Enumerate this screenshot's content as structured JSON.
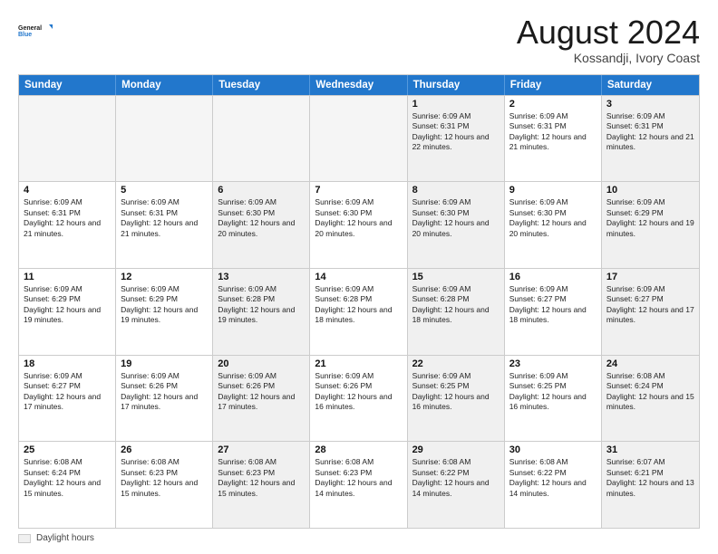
{
  "logo": {
    "line1": "General",
    "line2": "Blue"
  },
  "header": {
    "title": "August 2024",
    "subtitle": "Kossandji, Ivory Coast"
  },
  "days": [
    "Sunday",
    "Monday",
    "Tuesday",
    "Wednesday",
    "Thursday",
    "Friday",
    "Saturday"
  ],
  "legend": {
    "box_label": "Daylight hours"
  },
  "weeks": [
    [
      {
        "day": "",
        "content": ""
      },
      {
        "day": "",
        "content": ""
      },
      {
        "day": "",
        "content": ""
      },
      {
        "day": "",
        "content": ""
      },
      {
        "day": "1",
        "content": "Sunrise: 6:09 AM\nSunset: 6:31 PM\nDaylight: 12 hours and 22 minutes."
      },
      {
        "day": "2",
        "content": "Sunrise: 6:09 AM\nSunset: 6:31 PM\nDaylight: 12 hours and 21 minutes."
      },
      {
        "day": "3",
        "content": "Sunrise: 6:09 AM\nSunset: 6:31 PM\nDaylight: 12 hours and 21 minutes."
      }
    ],
    [
      {
        "day": "4",
        "content": "Sunrise: 6:09 AM\nSunset: 6:31 PM\nDaylight: 12 hours and 21 minutes."
      },
      {
        "day": "5",
        "content": "Sunrise: 6:09 AM\nSunset: 6:31 PM\nDaylight: 12 hours and 21 minutes."
      },
      {
        "day": "6",
        "content": "Sunrise: 6:09 AM\nSunset: 6:30 PM\nDaylight: 12 hours and 20 minutes."
      },
      {
        "day": "7",
        "content": "Sunrise: 6:09 AM\nSunset: 6:30 PM\nDaylight: 12 hours and 20 minutes."
      },
      {
        "day": "8",
        "content": "Sunrise: 6:09 AM\nSunset: 6:30 PM\nDaylight: 12 hours and 20 minutes."
      },
      {
        "day": "9",
        "content": "Sunrise: 6:09 AM\nSunset: 6:30 PM\nDaylight: 12 hours and 20 minutes."
      },
      {
        "day": "10",
        "content": "Sunrise: 6:09 AM\nSunset: 6:29 PM\nDaylight: 12 hours and 19 minutes."
      }
    ],
    [
      {
        "day": "11",
        "content": "Sunrise: 6:09 AM\nSunset: 6:29 PM\nDaylight: 12 hours and 19 minutes."
      },
      {
        "day": "12",
        "content": "Sunrise: 6:09 AM\nSunset: 6:29 PM\nDaylight: 12 hours and 19 minutes."
      },
      {
        "day": "13",
        "content": "Sunrise: 6:09 AM\nSunset: 6:28 PM\nDaylight: 12 hours and 19 minutes."
      },
      {
        "day": "14",
        "content": "Sunrise: 6:09 AM\nSunset: 6:28 PM\nDaylight: 12 hours and 18 minutes."
      },
      {
        "day": "15",
        "content": "Sunrise: 6:09 AM\nSunset: 6:28 PM\nDaylight: 12 hours and 18 minutes."
      },
      {
        "day": "16",
        "content": "Sunrise: 6:09 AM\nSunset: 6:27 PM\nDaylight: 12 hours and 18 minutes."
      },
      {
        "day": "17",
        "content": "Sunrise: 6:09 AM\nSunset: 6:27 PM\nDaylight: 12 hours and 17 minutes."
      }
    ],
    [
      {
        "day": "18",
        "content": "Sunrise: 6:09 AM\nSunset: 6:27 PM\nDaylight: 12 hours and 17 minutes."
      },
      {
        "day": "19",
        "content": "Sunrise: 6:09 AM\nSunset: 6:26 PM\nDaylight: 12 hours and 17 minutes."
      },
      {
        "day": "20",
        "content": "Sunrise: 6:09 AM\nSunset: 6:26 PM\nDaylight: 12 hours and 17 minutes."
      },
      {
        "day": "21",
        "content": "Sunrise: 6:09 AM\nSunset: 6:26 PM\nDaylight: 12 hours and 16 minutes."
      },
      {
        "day": "22",
        "content": "Sunrise: 6:09 AM\nSunset: 6:25 PM\nDaylight: 12 hours and 16 minutes."
      },
      {
        "day": "23",
        "content": "Sunrise: 6:09 AM\nSunset: 6:25 PM\nDaylight: 12 hours and 16 minutes."
      },
      {
        "day": "24",
        "content": "Sunrise: 6:08 AM\nSunset: 6:24 PM\nDaylight: 12 hours and 15 minutes."
      }
    ],
    [
      {
        "day": "25",
        "content": "Sunrise: 6:08 AM\nSunset: 6:24 PM\nDaylight: 12 hours and 15 minutes."
      },
      {
        "day": "26",
        "content": "Sunrise: 6:08 AM\nSunset: 6:23 PM\nDaylight: 12 hours and 15 minutes."
      },
      {
        "day": "27",
        "content": "Sunrise: 6:08 AM\nSunset: 6:23 PM\nDaylight: 12 hours and 15 minutes."
      },
      {
        "day": "28",
        "content": "Sunrise: 6:08 AM\nSunset: 6:23 PM\nDaylight: 12 hours and 14 minutes."
      },
      {
        "day": "29",
        "content": "Sunrise: 6:08 AM\nSunset: 6:22 PM\nDaylight: 12 hours and 14 minutes."
      },
      {
        "day": "30",
        "content": "Sunrise: 6:08 AM\nSunset: 6:22 PM\nDaylight: 12 hours and 14 minutes."
      },
      {
        "day": "31",
        "content": "Sunrise: 6:07 AM\nSunset: 6:21 PM\nDaylight: 12 hours and 13 minutes."
      }
    ]
  ]
}
